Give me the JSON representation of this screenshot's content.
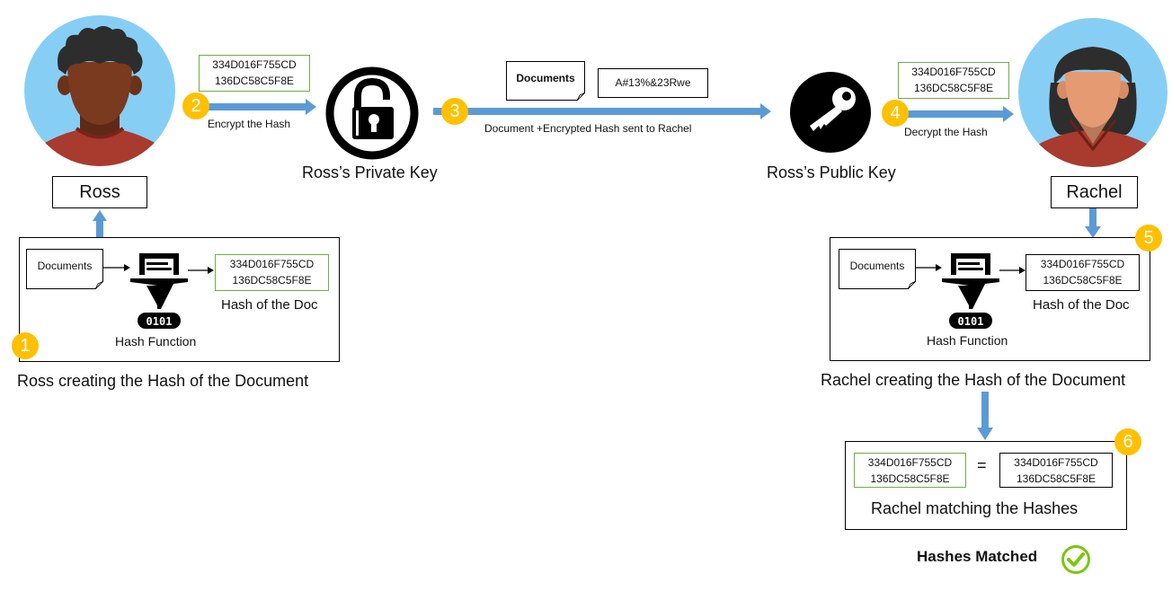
{
  "colors": {
    "arrow": "#5b9bd5",
    "badge": "#ffc000",
    "hash_border_green": "#70ad47",
    "check": "#7ac70c",
    "avatar_bg": "#87cef5",
    "shirt": "#a93a2e"
  },
  "actors": {
    "sender": {
      "name": "Ross",
      "icon": "male-avatar-icon"
    },
    "receiver": {
      "name": "Rachel",
      "icon": "female-avatar-icon"
    }
  },
  "hash_value": {
    "line1": "334D016F755CD",
    "line2": "136DC58C5F8E"
  },
  "keys": {
    "private": {
      "label": "Ross’s Private Key",
      "icon": "padlock-icon"
    },
    "public": {
      "label": "Ross’s Public Key",
      "icon": "key-icon"
    }
  },
  "steps": [
    {
      "number": "1",
      "caption": "Ross creating the Hash of the Document"
    },
    {
      "number": "2",
      "caption": "Encrypt the Hash"
    },
    {
      "number": "3",
      "caption": "Document +Encrypted Hash sent to Rachel"
    },
    {
      "number": "4",
      "caption": "Decrypt the Hash"
    },
    {
      "number": "5",
      "caption": "Rachel creating the Hash of the Document"
    },
    {
      "number": "6",
      "caption": "Rachel matching the Hashes"
    }
  ],
  "hashing": {
    "document_label": "Documents",
    "function_label": "Hash Function",
    "function_icon": "hash-funnel-icon",
    "output_label": "Hash of the Doc"
  },
  "transmission": {
    "document_label": "Documents",
    "encrypted_hash": "A#13%&23Rwe"
  },
  "comparison": {
    "operator": "="
  },
  "result": {
    "label": "Hashes Matched",
    "icon": "check-circle-icon"
  }
}
